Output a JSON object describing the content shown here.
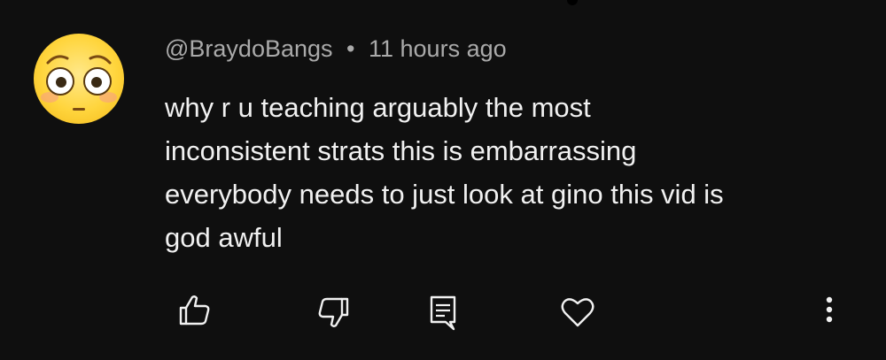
{
  "comment": {
    "author": "@BraydoBangs",
    "separator": "•",
    "timestamp": "11 hours ago",
    "avatar_icon": "flushed-face-emoji",
    "text_lines": [
      "why r u teaching arguably the most",
      "inconsistent strats this is embarrassing",
      "everybody needs to just look at gino this vid is",
      "god awful"
    ]
  },
  "actions": {
    "like_icon": "thumbs-up-icon",
    "dislike_icon": "thumbs-down-icon",
    "reply_icon": "reply-icon",
    "heart_icon": "heart-icon",
    "more_icon": "more-vertical-icon"
  },
  "colors": {
    "background": "#0f0f0f",
    "text": "#f1f1f1",
    "meta": "#aaaaaa",
    "avatar": "#ffd53d"
  }
}
